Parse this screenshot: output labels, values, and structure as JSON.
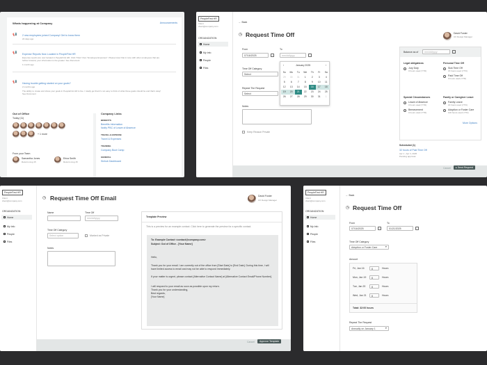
{
  "colors": {
    "teal": "#2e8b84",
    "dark_teal": "#4a5a59",
    "footer": "#e3e6e6",
    "bg": "#2b2b2d"
  },
  "dashboard": {
    "whats_happening": "Whats happening at Company",
    "announcements": "Announcements",
    "posts": [
      {
        "title": "2 new employees joined Company! Get to know them",
        "time": "22 days ago"
      },
      {
        "title": "Expense Reports Now Located in PeopleFirst HR",
        "body": "Expense reports are now located in PeopleFirst HR. Click \"Files\" then \"Employee Expenses\". Please know that in tune with other employees that are further forward, your information is the greater. See Document",
        "time": "1 month ago"
      },
      {
        "title": "Having trouble getting started on your goals?",
        "body": "The ability to create and share your goals in PeopleFirst HR is live. I totally get that it's not easy to think of what those goals should be and that's okay! See Document",
        "time": "2 months ago"
      }
    ],
    "out_of_office": "Out of Office",
    "today": "Today (11)",
    "more": "+ 1 more",
    "from_team": "From your Team",
    "team": [
      {
        "name": "Samantha Jones",
        "status": "Returns Aug 15"
      },
      {
        "name": "Erica Smith",
        "status": "Returns Aug 15"
      }
    ],
    "company_links": "Company Links",
    "link_groups": [
      {
        "title": "BENEFITS",
        "items": [
          "Benefits Information",
          "Notify PBC of Leave of Absence"
        ]
      },
      {
        "title": "TRAVEL & EXPENSE",
        "items": [
          "Travel & Expenses"
        ]
      },
      {
        "title": "TRAINING",
        "items": [
          "Company Boot Camp"
        ]
      },
      {
        "title": "GENERAL",
        "items": [
          "Sinhub Dashboard"
        ]
      }
    ]
  },
  "sidebar": {
    "logo": "PeopleFirst HR",
    "user_line1": "Client",
    "user_line2": "client@company.com",
    "section": "ORGANIZATION",
    "items": [
      "Home",
      "My Info",
      "People",
      "Files"
    ]
  },
  "user": {
    "name": "David Foster",
    "role": "UX Design Manager"
  },
  "common": {
    "back": "Back",
    "cancel": "Cancel"
  },
  "request1": {
    "title": "Request Time Off",
    "from_label": "From",
    "from_value": "07/16/2025",
    "to_label": "To",
    "to_placeholder": "mm/dd/yyyy",
    "category_label": "Time Off Category",
    "category_value": "Select",
    "repeat_label": "Repeat The Request",
    "repeat_value": "Select",
    "notes_label": "Notes",
    "private_label": "Keep Reason Private",
    "calendar": {
      "month": "January 2025",
      "weekdays": [
        "Su",
        "Mo",
        "Tu",
        "We",
        "Th",
        "Fr",
        "Sa"
      ],
      "rows": [
        [
          "29",
          "30",
          "31",
          "1",
          "2",
          "3",
          "4"
        ],
        [
          "5",
          "6",
          "7",
          "8",
          "9",
          "10",
          "11"
        ],
        [
          "12",
          "13",
          "14",
          "15",
          "16",
          "17",
          "18"
        ],
        [
          "19",
          "20",
          "21",
          "22",
          "23",
          "24",
          "25"
        ],
        [
          "26",
          "27",
          "28",
          "29",
          "30",
          "31",
          "1"
        ]
      ]
    },
    "balance_label": "Balance as of",
    "balance_placeholder": "mm/dd/yyyy",
    "legal_title": "Legal obligations",
    "legal": [
      {
        "name": "Jury Duty",
        "detail": "0 hours used (YTD)"
      }
    ],
    "personal_title": "Personal Time Off",
    "personal": [
      {
        "name": "Sick Time Off",
        "detail": "15 hours used (YTD)"
      },
      {
        "name": "Paid Time Off",
        "detail": "0 hours used (YTD)"
      }
    ],
    "special_title": "Special Circumstances",
    "special": [
      {
        "name": "Leave of Absence",
        "detail": "0 hours used (YTD)"
      },
      {
        "name": "Bereavement",
        "detail": "0 hours used (YTD)"
      }
    ],
    "family_title": "Family or Caregiver Leave",
    "family": [
      {
        "name": "Family Leave",
        "detail": "16 hours used (YTD)"
      },
      {
        "name": "Adoption or Foster Care",
        "detail": "100 hours used (YTD)"
      }
    ],
    "more_options": "More Options",
    "scheduled_title": "Scheduled (1)",
    "scheduled_item": "32 hours of Paid Time Off",
    "scheduled_dates": "Apr 1 - Apr 4, 2025",
    "scheduled_status": "Pending approval",
    "send_label": "Send Request"
  },
  "email": {
    "title": "Request Time Off Email",
    "name_label": "Name",
    "timeoff_label": "Time Off",
    "timeoff_placeholder": "mm/dd/yyyy",
    "category_label": "Time Off Category",
    "category_placeholder": "Select option",
    "private_label": "Marked as Private",
    "notes_label": "Notes",
    "preview_title": "Template Preview",
    "preview_note": "This is a preview for an example contact. Click here to generate the preview for a specific contact.",
    "to_line": "To: Example Contact <contact@company.com>",
    "subject_line": "Subject: Out of Office - [Your Name]",
    "greeting": "Hello,",
    "para1": "Thank you for your email. I am currently out of the office from [Start Date] to [End Date]. During this time, I will have limited access to email and may not be able to respond immediately.",
    "para2": "If your matter is urgent, please contact [Alternative Contact Name] at [Alternative Contact Email/Phone Number].",
    "para3": "I will respond to your email as soon as possible upon my return.",
    "thanks": "Thank you for your understanding,",
    "regards": "Best regards,",
    "sign": "[Your Name]",
    "approve_label": "Approve Template"
  },
  "request2": {
    "title": "Request Time Off",
    "from_label": "From",
    "from_value": "07/16/2025",
    "to_label": "To",
    "to_value": "01/21/2025",
    "category_label": "Time Off Category",
    "category_value": "Adoption or Foster Care",
    "amount_label": "Amount",
    "amount_rows": [
      {
        "day": "Fri, Jan 16",
        "hours": "8"
      },
      {
        "day": "Mon, Jan 19",
        "hours": "8"
      },
      {
        "day": "Tue, Jan 20",
        "hours": "8"
      },
      {
        "day": "Wed, Jan 21",
        "hours": "8"
      }
    ],
    "hours_unit": "Hours",
    "total": "Total: 32:00 hours",
    "repeat_label": "Repeat The Request",
    "repeat_value": "Annually on January 1"
  }
}
